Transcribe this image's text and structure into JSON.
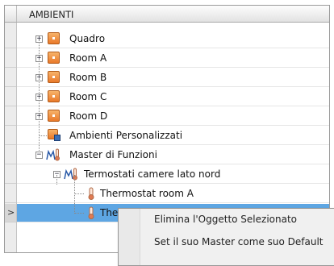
{
  "header": {
    "title": "AMBIENTI"
  },
  "tree": {
    "quadro": "Quadro",
    "room_a": "Room A",
    "room_b": "Room B",
    "room_c": "Room C",
    "room_d": "Room D",
    "custom": "Ambienti Personalizzati",
    "master": "Master di Funzioni",
    "termostati": "Termostati camere lato nord",
    "thermo_a": "Thermostat room A",
    "thermo_b_partial": "The"
  },
  "gutter": {
    "current_row_marker": ">"
  },
  "context_menu": {
    "items": [
      "Elimina l'Oggetto Selezionato",
      "Set il suo Master come suo Default"
    ]
  },
  "colors": {
    "selection": "#5ea6e3",
    "room_icon": "#e9792a",
    "menu_bg": "#f0f0f0"
  },
  "icons": {
    "expand": "plus-box",
    "collapse": "minus-box",
    "room": "orange-square",
    "custom": "orange-square-with-pencil",
    "master": "thermometer-group",
    "thermostat": "thermometer"
  }
}
